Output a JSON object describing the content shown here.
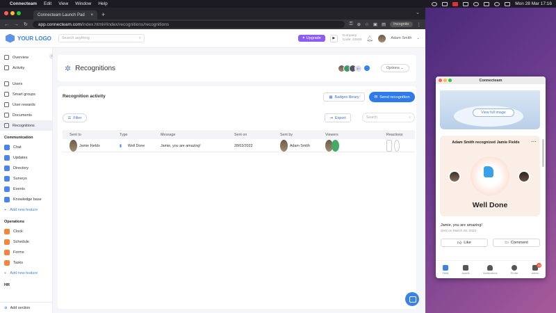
{
  "menubar": {
    "app": "Connecteam",
    "items": [
      "Edit",
      "View",
      "Window",
      "Help"
    ],
    "clock": "Mon 28 Mar  17:16"
  },
  "browser": {
    "tab_title": "Connecteam Launch Pad",
    "url_host": "app.connecteam.com",
    "url_path": "/index.html#/index/recognitions/recognitions",
    "incognito_label": "Incognito"
  },
  "header": {
    "logo": "YOUR LOGO",
    "search_placeholder": "Search anything",
    "upgrade_label": "Upgrade",
    "company_label": "Company",
    "company_code": "Code: 22533",
    "user_name": "Adam Smith"
  },
  "sidebar": {
    "top": [
      "Overview",
      "Activity"
    ],
    "main": [
      "Users",
      "Smart groups",
      "User rewards",
      "Documents",
      "Recognitions"
    ],
    "communication_title": "Communication",
    "communication": [
      "Chat",
      "Updates",
      "Directory",
      "Surveys",
      "Events",
      "Knowledge base"
    ],
    "add_feature": "Add new feature",
    "operations_title": "Operations",
    "operations": [
      "Clock",
      "Schedule",
      "Forms",
      "Tasks"
    ],
    "hr_title": "HR",
    "add_section": "Add section"
  },
  "page": {
    "title": "Recognitions",
    "viewer_extra": "3+",
    "options_label": "Options",
    "activity_title": "Recognition activity",
    "badges_label": "Badges library",
    "send_label": "Send recognition",
    "filter_label": "Filter",
    "export_label": "Export",
    "search_placeholder": "Search"
  },
  "table": {
    "columns": [
      "Sent to",
      "Type",
      "Message",
      "Sent on",
      "Sent by",
      "Viewers",
      "Reactions"
    ],
    "rows": [
      {
        "sent_to": "Jamie Fields",
        "type": "Well Done",
        "message": "Jamie, you are amazing!",
        "sent_on": "28/03/2022",
        "sent_by": "Adam Smith"
      }
    ]
  },
  "phone": {
    "title": "Connecteam",
    "view_full_image": "View full image",
    "card_title": "Adam Smith recognized Jamie Fields",
    "badge_text": "Well Done",
    "message": "Jamie, you are amazing!",
    "sent_on": "Sent on March 28, 2022",
    "like_label": "Like",
    "comment_label": "Comment",
    "nav": [
      "Feed",
      "Assets",
      "Notifications",
      "Profile",
      "Admin"
    ],
    "admin_badge": "15"
  }
}
